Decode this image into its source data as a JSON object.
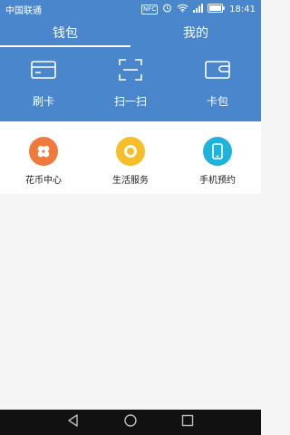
{
  "status_bar": {
    "carrier": "中国联通",
    "time": "18:41",
    "nfc_label": "NFC"
  },
  "tabs": [
    {
      "label": "钱包",
      "active": true
    },
    {
      "label": "我的",
      "active": false
    }
  ],
  "actions": [
    {
      "label": "刷卡",
      "icon": "card-icon"
    },
    {
      "label": "扫一扫",
      "icon": "scan-icon"
    },
    {
      "label": "卡包",
      "icon": "wallet-icon"
    }
  ],
  "services": [
    {
      "label": "花币中心",
      "icon": "flower-coin-icon",
      "color": "#f07a3c"
    },
    {
      "label": "生活服务",
      "icon": "ring-icon",
      "color": "#f6bf2a"
    },
    {
      "label": "手机预约",
      "icon": "phone-icon",
      "color": "#1fb3dc"
    }
  ],
  "colors": {
    "primary": "#4a86cc",
    "background": "#f5f5f5",
    "nav_bar": "#111111"
  }
}
